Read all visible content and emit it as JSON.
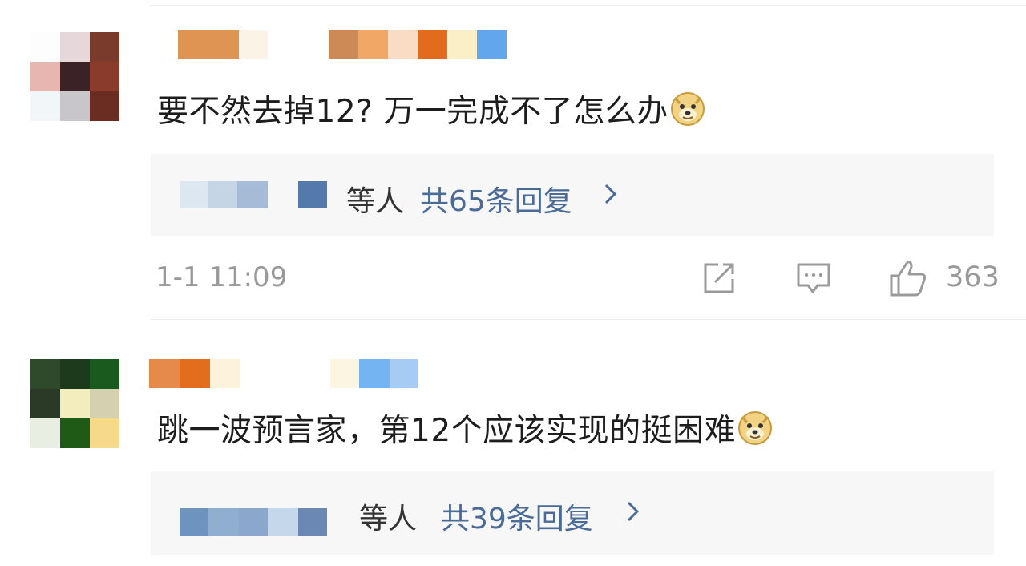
{
  "comments": [
    {
      "text": "要不然去掉12? 万一完成不了怎么办",
      "emoji": "doge-emoji",
      "reply_box": {
        "etc_label": "等人",
        "count_label": "共65条回复"
      },
      "time": "1-1 11:09",
      "actions": {
        "share": "share-icon",
        "comment": "comment-icon",
        "like": "thumbs-up-icon",
        "like_count": "363"
      }
    },
    {
      "text": "跳一波预言家，第12个应该实现的挺困难",
      "emoji": "doge-emoji",
      "reply_box": {
        "etc_label": "等人",
        "count_label": "共39条回复"
      }
    }
  ],
  "colors": {
    "link_blue": "#4a6b98",
    "meta_gray": "#999999",
    "reply_bg": "#f7f7f7"
  }
}
